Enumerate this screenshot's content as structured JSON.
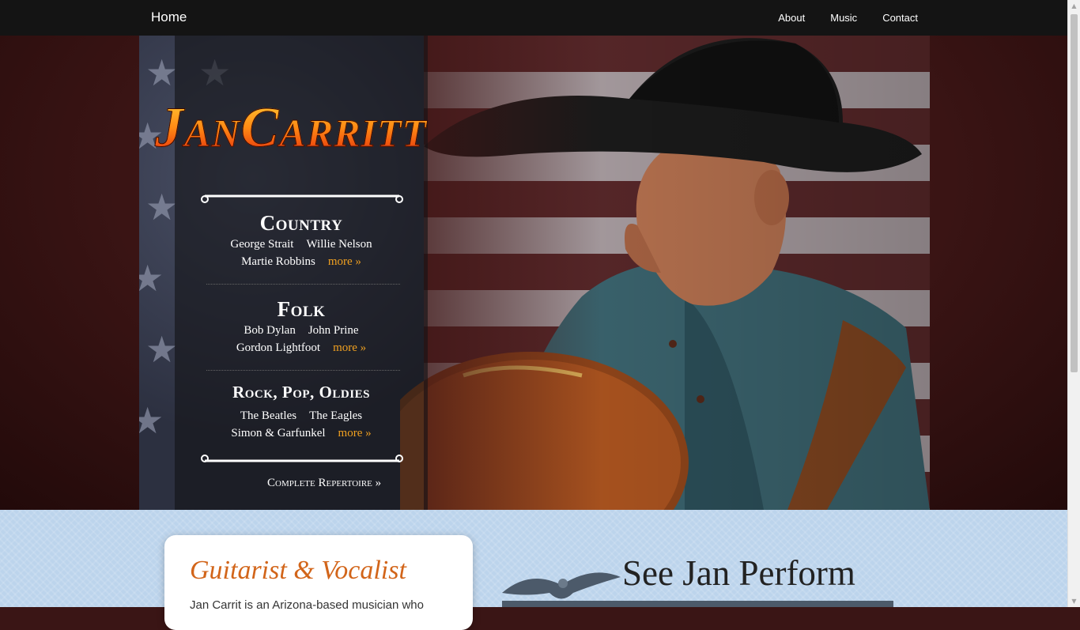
{
  "nav": {
    "brand": "Home",
    "links": [
      "About",
      "Music",
      "Contact"
    ]
  },
  "hero": {
    "logo_text": "JanCarritt",
    "genres": [
      {
        "title": "Country",
        "artists_line1": [
          "George Strait",
          "Willie Nelson"
        ],
        "artists_line2": "Martie Robbins",
        "more": "more »"
      },
      {
        "title": "Folk",
        "artists_line1": [
          "Bob Dylan",
          "John Prine"
        ],
        "artists_line2": "Gordon Lightfoot",
        "more": "more »"
      },
      {
        "title": "Rock, Pop, Oldies",
        "artists_line1": [
          "The Beatles",
          "The Eagles"
        ],
        "artists_line2": "Simon & Garfunkel",
        "more": "more »"
      }
    ],
    "repertoire_link": "Complete Repertoire »"
  },
  "intro": {
    "heading": "Guitarist & Vocalist",
    "text": "Jan Carrit is an Arizona-based musician who"
  },
  "perform": {
    "heading": "See Jan Perform"
  },
  "colors": {
    "accent": "#f0a020",
    "heading_orange": "#d2651a",
    "nav_bg": "#141414",
    "lower_bg": "#bcd4ec"
  }
}
